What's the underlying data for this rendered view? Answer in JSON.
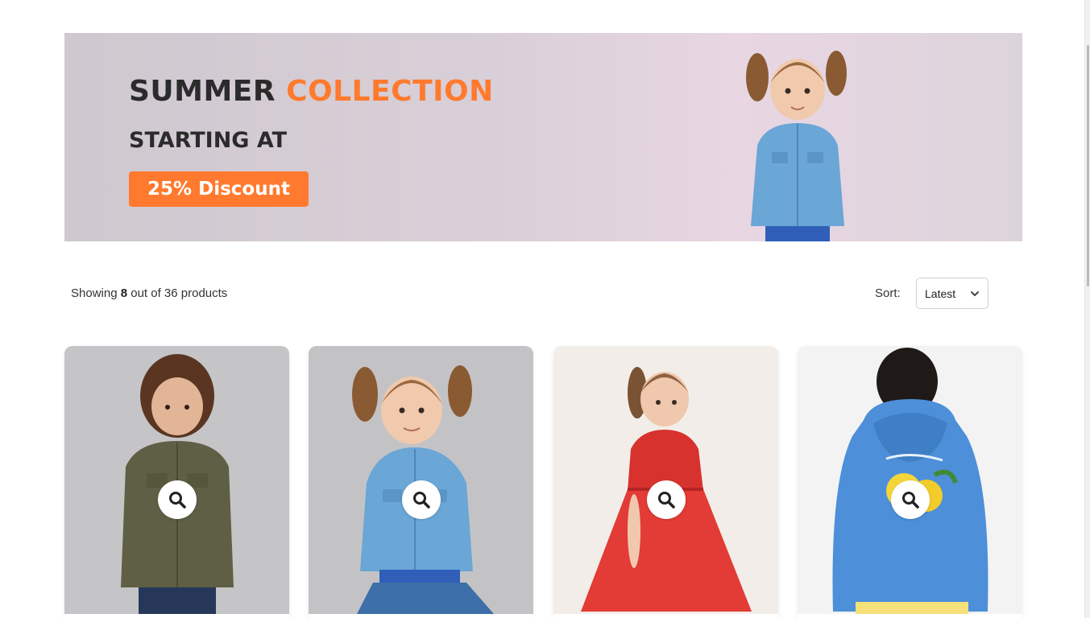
{
  "banner": {
    "title_part1": "SUMMER ",
    "title_part2": "COLLECTION",
    "subtitle": "STARTING AT",
    "badge": "25% Discount",
    "accent_color": "#ff7a2e"
  },
  "results": {
    "prefix": "Showing ",
    "shown": "8",
    "suffix": " out of 36 products"
  },
  "sort": {
    "label": "Sort:",
    "selected": "Latest"
  },
  "products": [
    {
      "quick_view_icon": "search-icon",
      "image": "boy in olive shirt"
    },
    {
      "quick_view_icon": "search-icon",
      "image": "girl in denim jacket"
    },
    {
      "quick_view_icon": "search-icon",
      "image": "girl in red dress"
    },
    {
      "quick_view_icon": "search-icon",
      "image": "boy in blue lemon hoodie"
    }
  ]
}
